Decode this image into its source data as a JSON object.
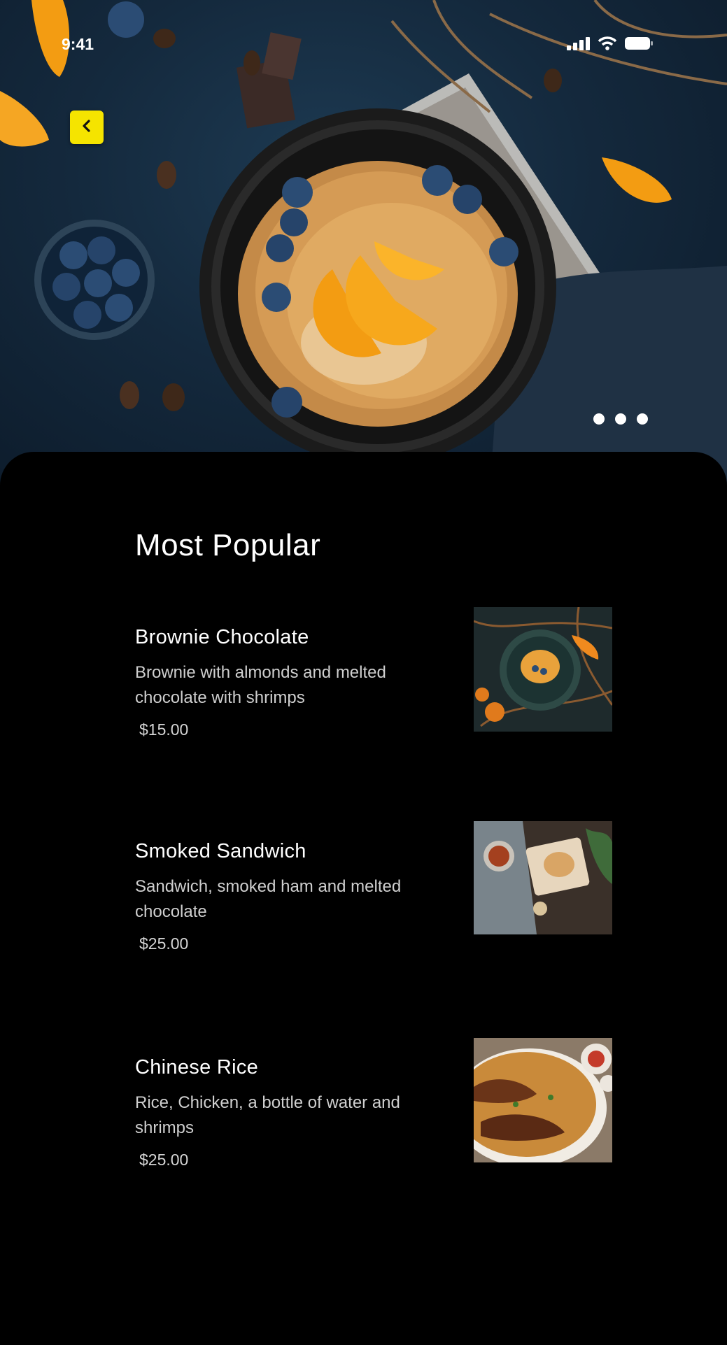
{
  "status": {
    "time": "9:41"
  },
  "icons": {
    "back": "chevron-left-icon",
    "signal": "signal-icon",
    "wifi": "wifi-icon",
    "battery": "battery-icon"
  },
  "colors": {
    "accent": "#f5e400",
    "background": "#000000"
  },
  "carousel": {
    "pages": 3
  },
  "section_title": "Most Popular",
  "items": [
    {
      "title": "Brownie Chocolate",
      "description": "Brownie with almonds and melted chocolate with shrimps",
      "price": "$15.00"
    },
    {
      "title": "Smoked Sandwich",
      "description": "Sandwich,  smoked ham and melted chocolate",
      "price": "$25.00"
    },
    {
      "title": "Chinese Rice",
      "description": "Rice, Chicken, a bottle of water and shrimps",
      "price": "$25.00"
    }
  ]
}
